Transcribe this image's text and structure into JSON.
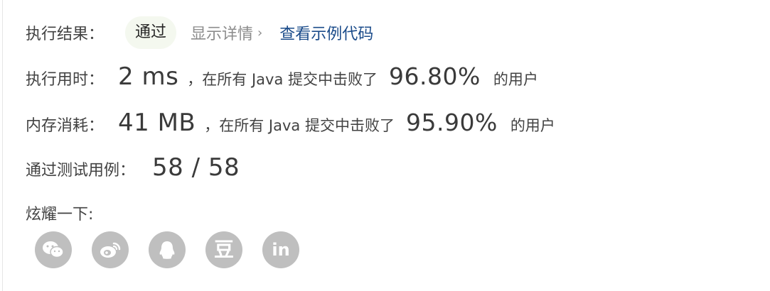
{
  "result": {
    "label": "执行结果：",
    "status": "通过",
    "details_link": "显示详情",
    "details_chevron": "›",
    "sample_link": "查看示例代码"
  },
  "runtime": {
    "label": "执行用时：",
    "value": "2 ms",
    "text_before": "，在所有 Java 提交中击败了",
    "percent": "96.80%",
    "text_after": "的用户"
  },
  "memory": {
    "label": "内存消耗：",
    "value": "41 MB",
    "text_before": "，在所有 Java 提交中击败了",
    "percent": "95.90%",
    "text_after": "的用户"
  },
  "tests": {
    "label": "通过测试用例：",
    "value": "58 / 58"
  },
  "share": {
    "label": "炫耀一下:",
    "icons": [
      "wechat-icon",
      "weibo-icon",
      "qq-icon",
      "douban-icon",
      "linkedin-icon"
    ],
    "douban_glyph": "豆",
    "linkedin_glyph": "in",
    "icon_bg": "#bfbfbf"
  },
  "colors": {
    "badge_bg": "#f4f8ef",
    "link": "#1a4b8a",
    "muted": "#8c8c8c"
  }
}
